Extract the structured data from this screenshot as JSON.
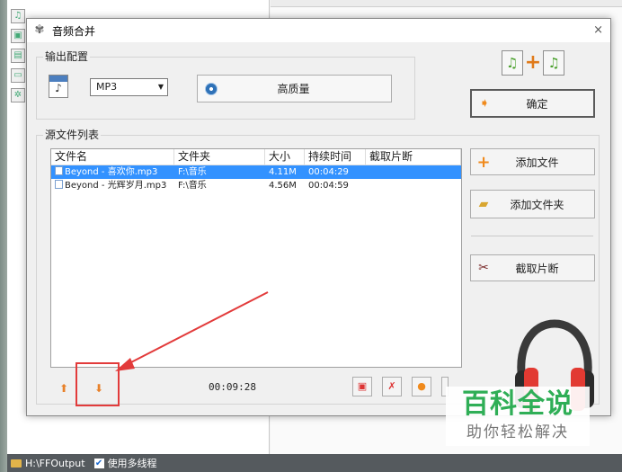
{
  "background": {
    "status_path": "H:\\FFOutput",
    "multithread_label": "使用多线程"
  },
  "dialog": {
    "title": "音频合并",
    "close": "×"
  },
  "output": {
    "group_label": "输出配置",
    "format_value": "MP3",
    "quality_label": "高质量"
  },
  "actions": {
    "confirm": "确定",
    "add_file": "添加文件",
    "add_folder": "添加文件夹",
    "clip": "截取片断"
  },
  "file_list": {
    "group_label": "源文件列表",
    "columns": [
      "文件名",
      "文件夹",
      "大小",
      "持续时间",
      "截取片断"
    ],
    "rows": [
      {
        "name": "Beyond - 喜欢你.mp3",
        "folder": "F:\\音乐",
        "size": "4.11M",
        "duration": "00:04:29",
        "clip": "",
        "selected": true
      },
      {
        "name": "Beyond - 光辉岁月.mp3",
        "folder": "F:\\音乐",
        "size": "4.56M",
        "duration": "00:04:59",
        "clip": "",
        "selected": false
      }
    ],
    "total_duration": "00:09:28"
  },
  "watermark": {
    "big": "百科全说",
    "small": "助你轻松解决"
  },
  "colors": {
    "selection": "#3392ff",
    "annotation_red": "#e23b3b",
    "watermark_green": "#2fae56"
  }
}
